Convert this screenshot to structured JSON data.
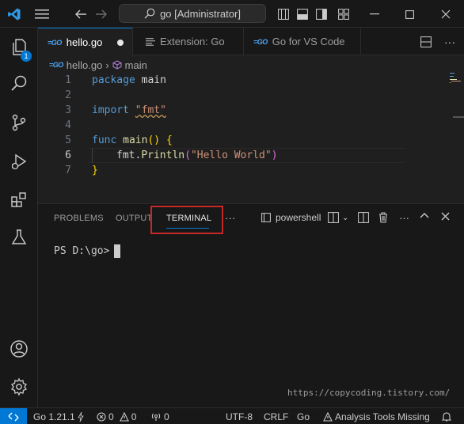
{
  "titlebar": {
    "search": "go [Administrator]"
  },
  "activity": {
    "explorer_badge": "1"
  },
  "tabs": [
    {
      "label": "hello.go",
      "icon": "go-icon",
      "dirty": true
    },
    {
      "label": "Extension: Go",
      "icon": "extension-doc-icon"
    },
    {
      "label": "Go for VS Code",
      "icon": "go-icon"
    }
  ],
  "breadcrumb": {
    "file": "hello.go",
    "symbol": "main"
  },
  "editor": {
    "line_numbers": [
      "1",
      "2",
      "3",
      "4",
      "5",
      "6",
      "7"
    ],
    "l1_kw": "package",
    "l1_name": "main",
    "l3_kw": "import",
    "l3_str": "\"fmt\"",
    "l5_kw": "func",
    "l5_fn": "main",
    "l5_paren": "()",
    "l5_brace": "{",
    "l6_obj": "fmt.",
    "l6_fn": "Println",
    "l6_open": "(",
    "l6_str": "\"Hello World\"",
    "l6_close": ")",
    "l7_brace": "}"
  },
  "panel": {
    "tabs": [
      "PROBLEMS",
      "OUTPUT",
      "TERMINAL"
    ],
    "more": "···",
    "shell": "powershell",
    "prompt": "PS D:\\go>"
  },
  "watermark": "https://copycoding.tistory.com/",
  "status": {
    "go_version": "Go 1.21.1",
    "errors": "0",
    "warnings": "0",
    "ports": "0",
    "encoding": "UTF-8",
    "eol": "CRLF",
    "language": "Go",
    "analysis": "Analysis Tools Missing"
  },
  "colors": {
    "accent": "#0078d4",
    "highlight_border": "#c62828"
  }
}
